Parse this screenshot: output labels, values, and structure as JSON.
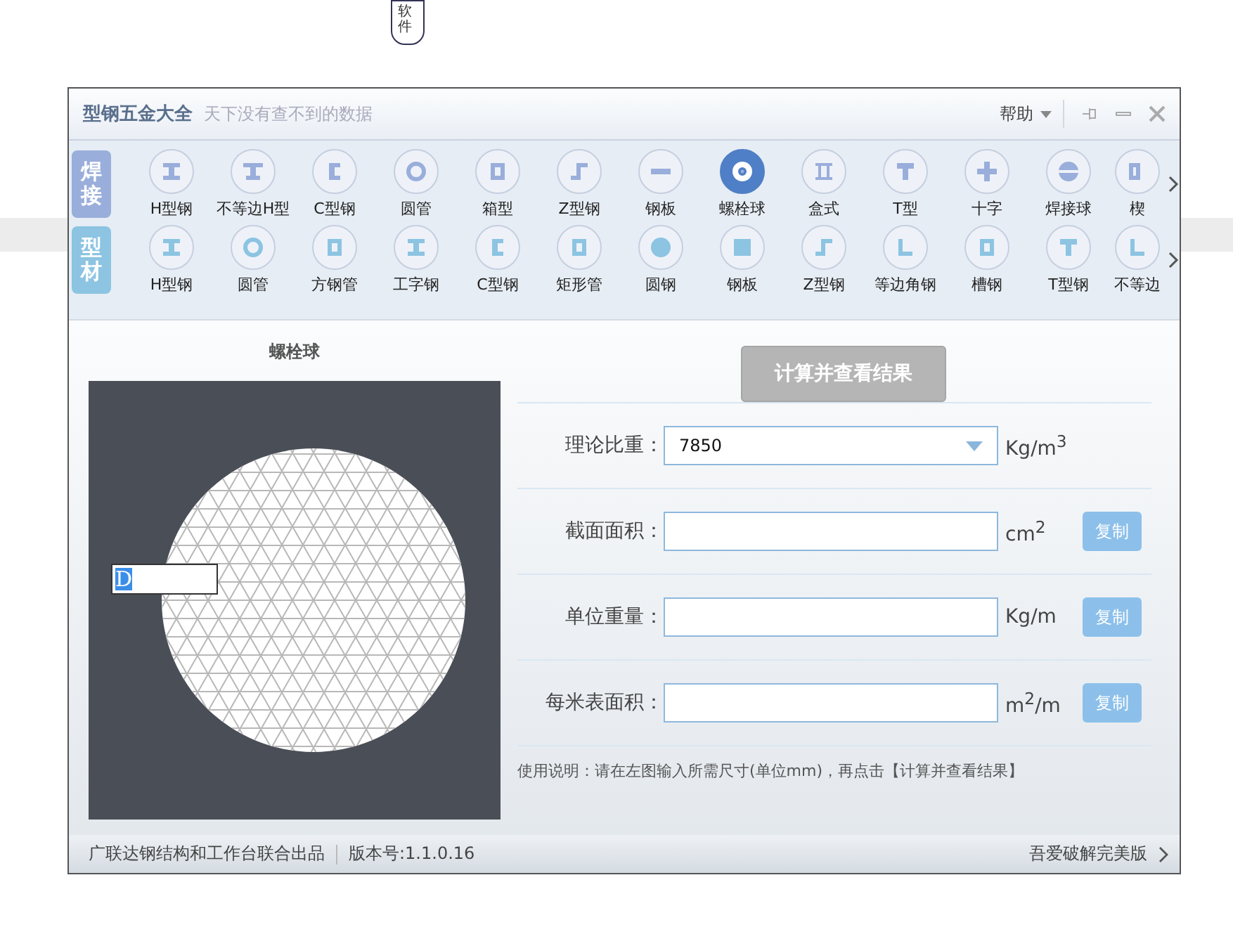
{
  "stamp": {
    "text": "软件"
  },
  "window": {
    "title": "型钢五金大全",
    "subtitle": "天下没有查不到的数据",
    "help": "帮助"
  },
  "categories": [
    {
      "label": "焊接",
      "color": "#9aaedb",
      "items": [
        {
          "label": "H型钢",
          "kind": "ibeam",
          "selected": false
        },
        {
          "label": "不等边H型",
          "kind": "unequal",
          "selected": false
        },
        {
          "label": "C型钢",
          "kind": "channel",
          "selected": false
        },
        {
          "label": "圆管",
          "kind": "ring",
          "selected": false
        },
        {
          "label": "箱型",
          "kind": "box",
          "selected": false
        },
        {
          "label": "Z型钢",
          "kind": "zee",
          "selected": false
        },
        {
          "label": "钢板",
          "kind": "plate",
          "selected": false
        },
        {
          "label": "螺栓球",
          "kind": "bolt",
          "selected": true
        },
        {
          "label": "盒式",
          "kind": "girder",
          "selected": false
        },
        {
          "label": "T型",
          "kind": "tee",
          "selected": false
        },
        {
          "label": "十字",
          "kind": "cross",
          "selected": false
        },
        {
          "label": "焊接球",
          "kind": "weld",
          "selected": false
        },
        {
          "label": "楔",
          "kind": "wedge",
          "selected": false
        }
      ]
    },
    {
      "label": "型材",
      "color": "#8cc4e2",
      "items": [
        {
          "label": "H型钢",
          "kind": "ibeam",
          "selected": false
        },
        {
          "label": "圆管",
          "kind": "ring",
          "selected": false
        },
        {
          "label": "方钢管",
          "kind": "box",
          "selected": false
        },
        {
          "label": "工字钢",
          "kind": "ibeam",
          "selected": false
        },
        {
          "label": "C型钢",
          "kind": "channel",
          "selected": false
        },
        {
          "label": "矩形管",
          "kind": "box",
          "selected": false
        },
        {
          "label": "圆钢",
          "kind": "solid",
          "selected": false
        },
        {
          "label": "钢板",
          "kind": "hatch",
          "selected": false
        },
        {
          "label": "Z型钢",
          "kind": "zee",
          "selected": false
        },
        {
          "label": "等边角钢",
          "kind": "angle",
          "selected": false
        },
        {
          "label": "槽钢",
          "kind": "box",
          "selected": false
        },
        {
          "label": "T型钢",
          "kind": "tee",
          "selected": false
        },
        {
          "label": "不等边",
          "kind": "angle",
          "selected": false
        }
      ]
    }
  ],
  "panel": {
    "title": "螺栓球",
    "dimension": "D"
  },
  "calc_button": "计算并查看结果",
  "fields": [
    {
      "label": "理论比重：",
      "kind": "select",
      "value": "7850",
      "unit": "Kg/m$^{3}$"
    },
    {
      "label": "截面面积：",
      "kind": "output",
      "unit": "cm$^{2}$",
      "copy": "复制"
    },
    {
      "label": "单位重量：",
      "kind": "output",
      "unit": "Kg/m",
      "copy": "复制"
    },
    {
      "label": "每米表面积：",
      "kind": "output",
      "unit": "m$^{2}$/m",
      "copy": "复制"
    }
  ],
  "note": "使用说明：请在左图输入所需尺寸(单位mm)，再点击【计算并查看结果】",
  "status_bar": {
    "credit": "广联达钢结构和工作台联合出品",
    "version": "版本号:1.1.0.16",
    "link": "吾爱破解完美版"
  }
}
